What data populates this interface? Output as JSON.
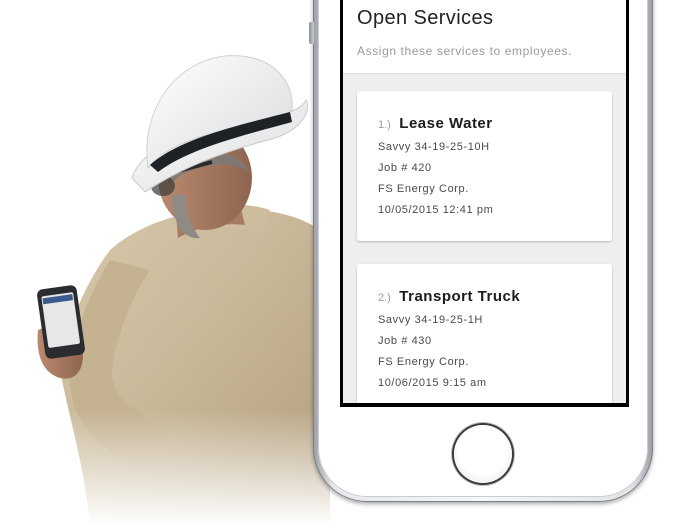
{
  "header": {
    "title": "Open Services",
    "subtitle": "Assign these services to employees."
  },
  "services": [
    {
      "number": "1.)",
      "name": "Lease Water",
      "location": "Savvy 34-19-25-10H",
      "job": "Job # 420",
      "company": "FS Energy Corp.",
      "datetime": "10/05/2015 12:41 pm"
    },
    {
      "number": "2.)",
      "name": "Transport Truck",
      "location": "Savvy 34-19-25-1H",
      "job": "Job # 430",
      "company": "FS Energy Corp.",
      "datetime": "10/06/2015 9:15 am"
    }
  ]
}
